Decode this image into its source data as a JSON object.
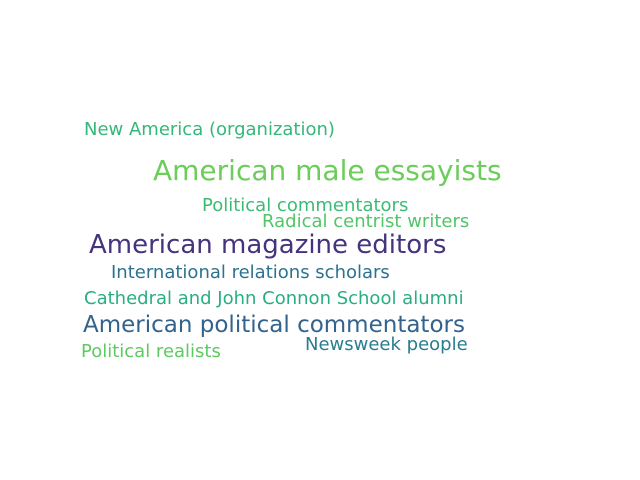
{
  "words": [
    {
      "text": "New America (organization)",
      "color": "#35b779"
    },
    {
      "text": "American male essayists",
      "color": "#6ccd5a"
    },
    {
      "text": "Political commentators",
      "color": "#3bbb75"
    },
    {
      "text": "Radical centrist writers",
      "color": "#52c569"
    },
    {
      "text": "American magazine editors",
      "color": "#46337e"
    },
    {
      "text": "International relations scholars",
      "color": "#2c728e"
    },
    {
      "text": "Cathedral and John Connon School alumni",
      "color": "#29af7f"
    },
    {
      "text": "American political commentators",
      "color": "#33638d"
    },
    {
      "text": "Political realists",
      "color": "#5ec962"
    },
    {
      "text": "Newsweek people",
      "color": "#287d8e"
    }
  ]
}
